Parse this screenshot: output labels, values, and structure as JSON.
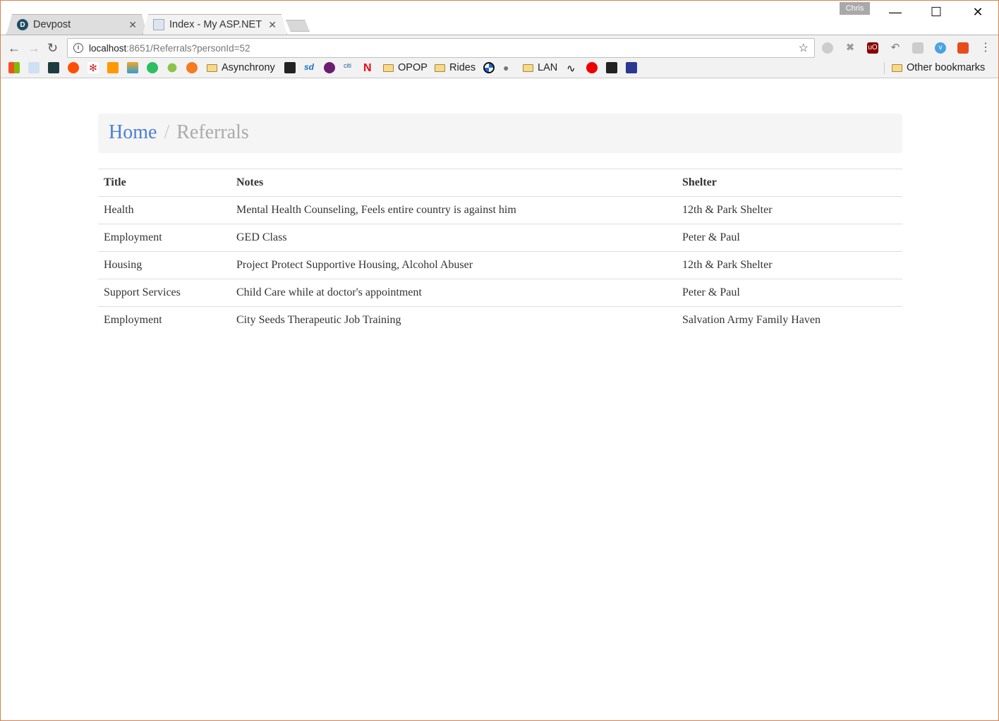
{
  "browser": {
    "tabs": [
      {
        "label": "Devpost",
        "active": false
      },
      {
        "label": "Index - My ASP.NET",
        "active": true
      }
    ],
    "profile": "Chris",
    "url": {
      "host": "localhost",
      "path": ":8651/Referrals?personId=52"
    },
    "bookmarks": {
      "folders": [
        "Asynchrony",
        "OPOP",
        "Rides",
        "LAN"
      ],
      "other": "Other bookmarks"
    }
  },
  "breadcrumb": {
    "home": "Home",
    "separator": "/",
    "current": "Referrals"
  },
  "table": {
    "headers": [
      "Title",
      "Notes",
      "Shelter"
    ],
    "rows": [
      [
        "Health",
        "Mental Health Counseling, Feels entire country is against him",
        "12th & Park Shelter"
      ],
      [
        "Employment",
        "GED Class",
        "Peter & Paul"
      ],
      [
        "Housing",
        "Project Protect Supportive Housing, Alcohol Abuser",
        "12th & Park Shelter"
      ],
      [
        "Support Services",
        "Child Care while at doctor's appointment",
        "Peter & Paul"
      ],
      [
        "Employment",
        "City Seeds Therapeutic Job Training",
        "Salvation Army Family Haven"
      ]
    ]
  }
}
